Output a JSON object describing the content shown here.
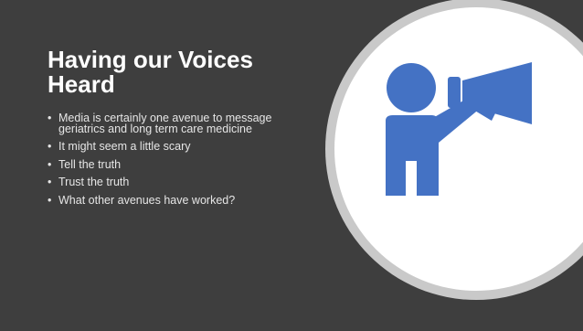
{
  "slide": {
    "title": "Having our Voices Heard",
    "bullets": [
      "Media is certainly one avenue to message geriatrics and long term care medicine",
      "It might seem a little scary",
      "Tell the truth",
      "Trust the truth",
      "What other avenues have worked?"
    ],
    "bullet_char": "•",
    "image_icon": "person-with-megaphone-icon"
  },
  "colors": {
    "background": "#3e3e3e",
    "circle_ring": "#c9c9c9",
    "circle_fill": "#ffffff",
    "icon": "#4472c4",
    "title_text": "#ffffff",
    "body_text": "#e6e6e6"
  }
}
